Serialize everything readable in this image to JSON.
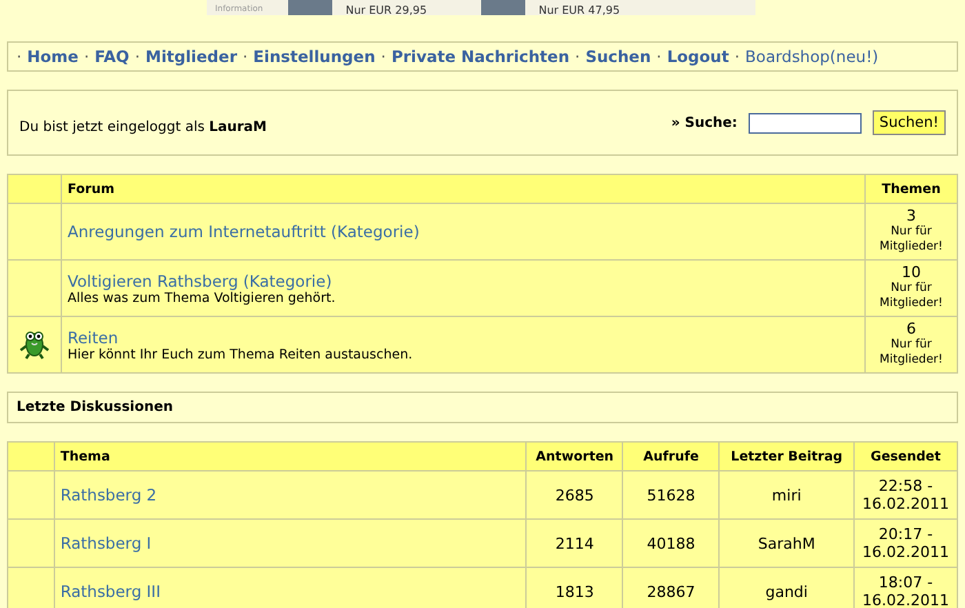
{
  "banner": {
    "caption": "Information",
    "products": [
      {
        "price": "Nur EUR 29,95"
      },
      {
        "price": "Nur EUR 47,95"
      }
    ]
  },
  "nav": {
    "separator": "·",
    "links": [
      {
        "label": "Home",
        "bold": true
      },
      {
        "label": "FAQ",
        "bold": true
      },
      {
        "label": "Mitglieder",
        "bold": true
      },
      {
        "label": "Einstellungen",
        "bold": true
      },
      {
        "label": "Private Nachrichten",
        "bold": true
      },
      {
        "label": "Suchen",
        "bold": true
      },
      {
        "label": "Logout",
        "bold": true
      },
      {
        "label": "Boardshop(neu!)",
        "bold": false
      }
    ]
  },
  "login": {
    "text": "Du bist jetzt eingeloggt als **LauraM**",
    "search_label": "» Suche:",
    "search_button": "Suchen!"
  },
  "forums": {
    "columns": [
      "Forum",
      "Themen"
    ],
    "rows": [
      {
        "kind": "category",
        "title": "Anregungen zum Internetauftritt (Kategorie)",
        "topics": "3",
        "note": "Nur für Mitglieder!"
      },
      {
        "kind": "category",
        "title": "Voltigieren Rathsberg (Kategorie)",
        "description": "Alles was zum Thema Voltigieren gehört.",
        "topics": "10",
        "note": "Nur für Mitglieder!"
      },
      {
        "kind": "forum",
        "title": "Reiten",
        "description": "Hier könnt Ihr Euch zum Thema Reiten austauschen.",
        "topics": "6",
        "note": "Nur für Mitglieder!"
      }
    ]
  },
  "recent": {
    "title": "Letzte Diskussionen",
    "columns": [
      "Thema",
      "Antworten",
      "Aufrufe",
      "Letzter Beitrag",
      "Gesendet"
    ],
    "rows": [
      {
        "topic": "Rathsberg 2",
        "replies": "2685",
        "views": "51628",
        "last_by": "miri",
        "sent": "22:58 - 16.02.2011"
      },
      {
        "topic": "Rathsberg I",
        "replies": "2114",
        "views": "40188",
        "last_by": "SarahM",
        "sent": "20:17 - 16.02.2011"
      },
      {
        "topic": "Rathsberg III",
        "replies": "1813",
        "views": "28867",
        "last_by": "gandi",
        "sent": "18:07 - 16.02.2011"
      }
    ]
  }
}
